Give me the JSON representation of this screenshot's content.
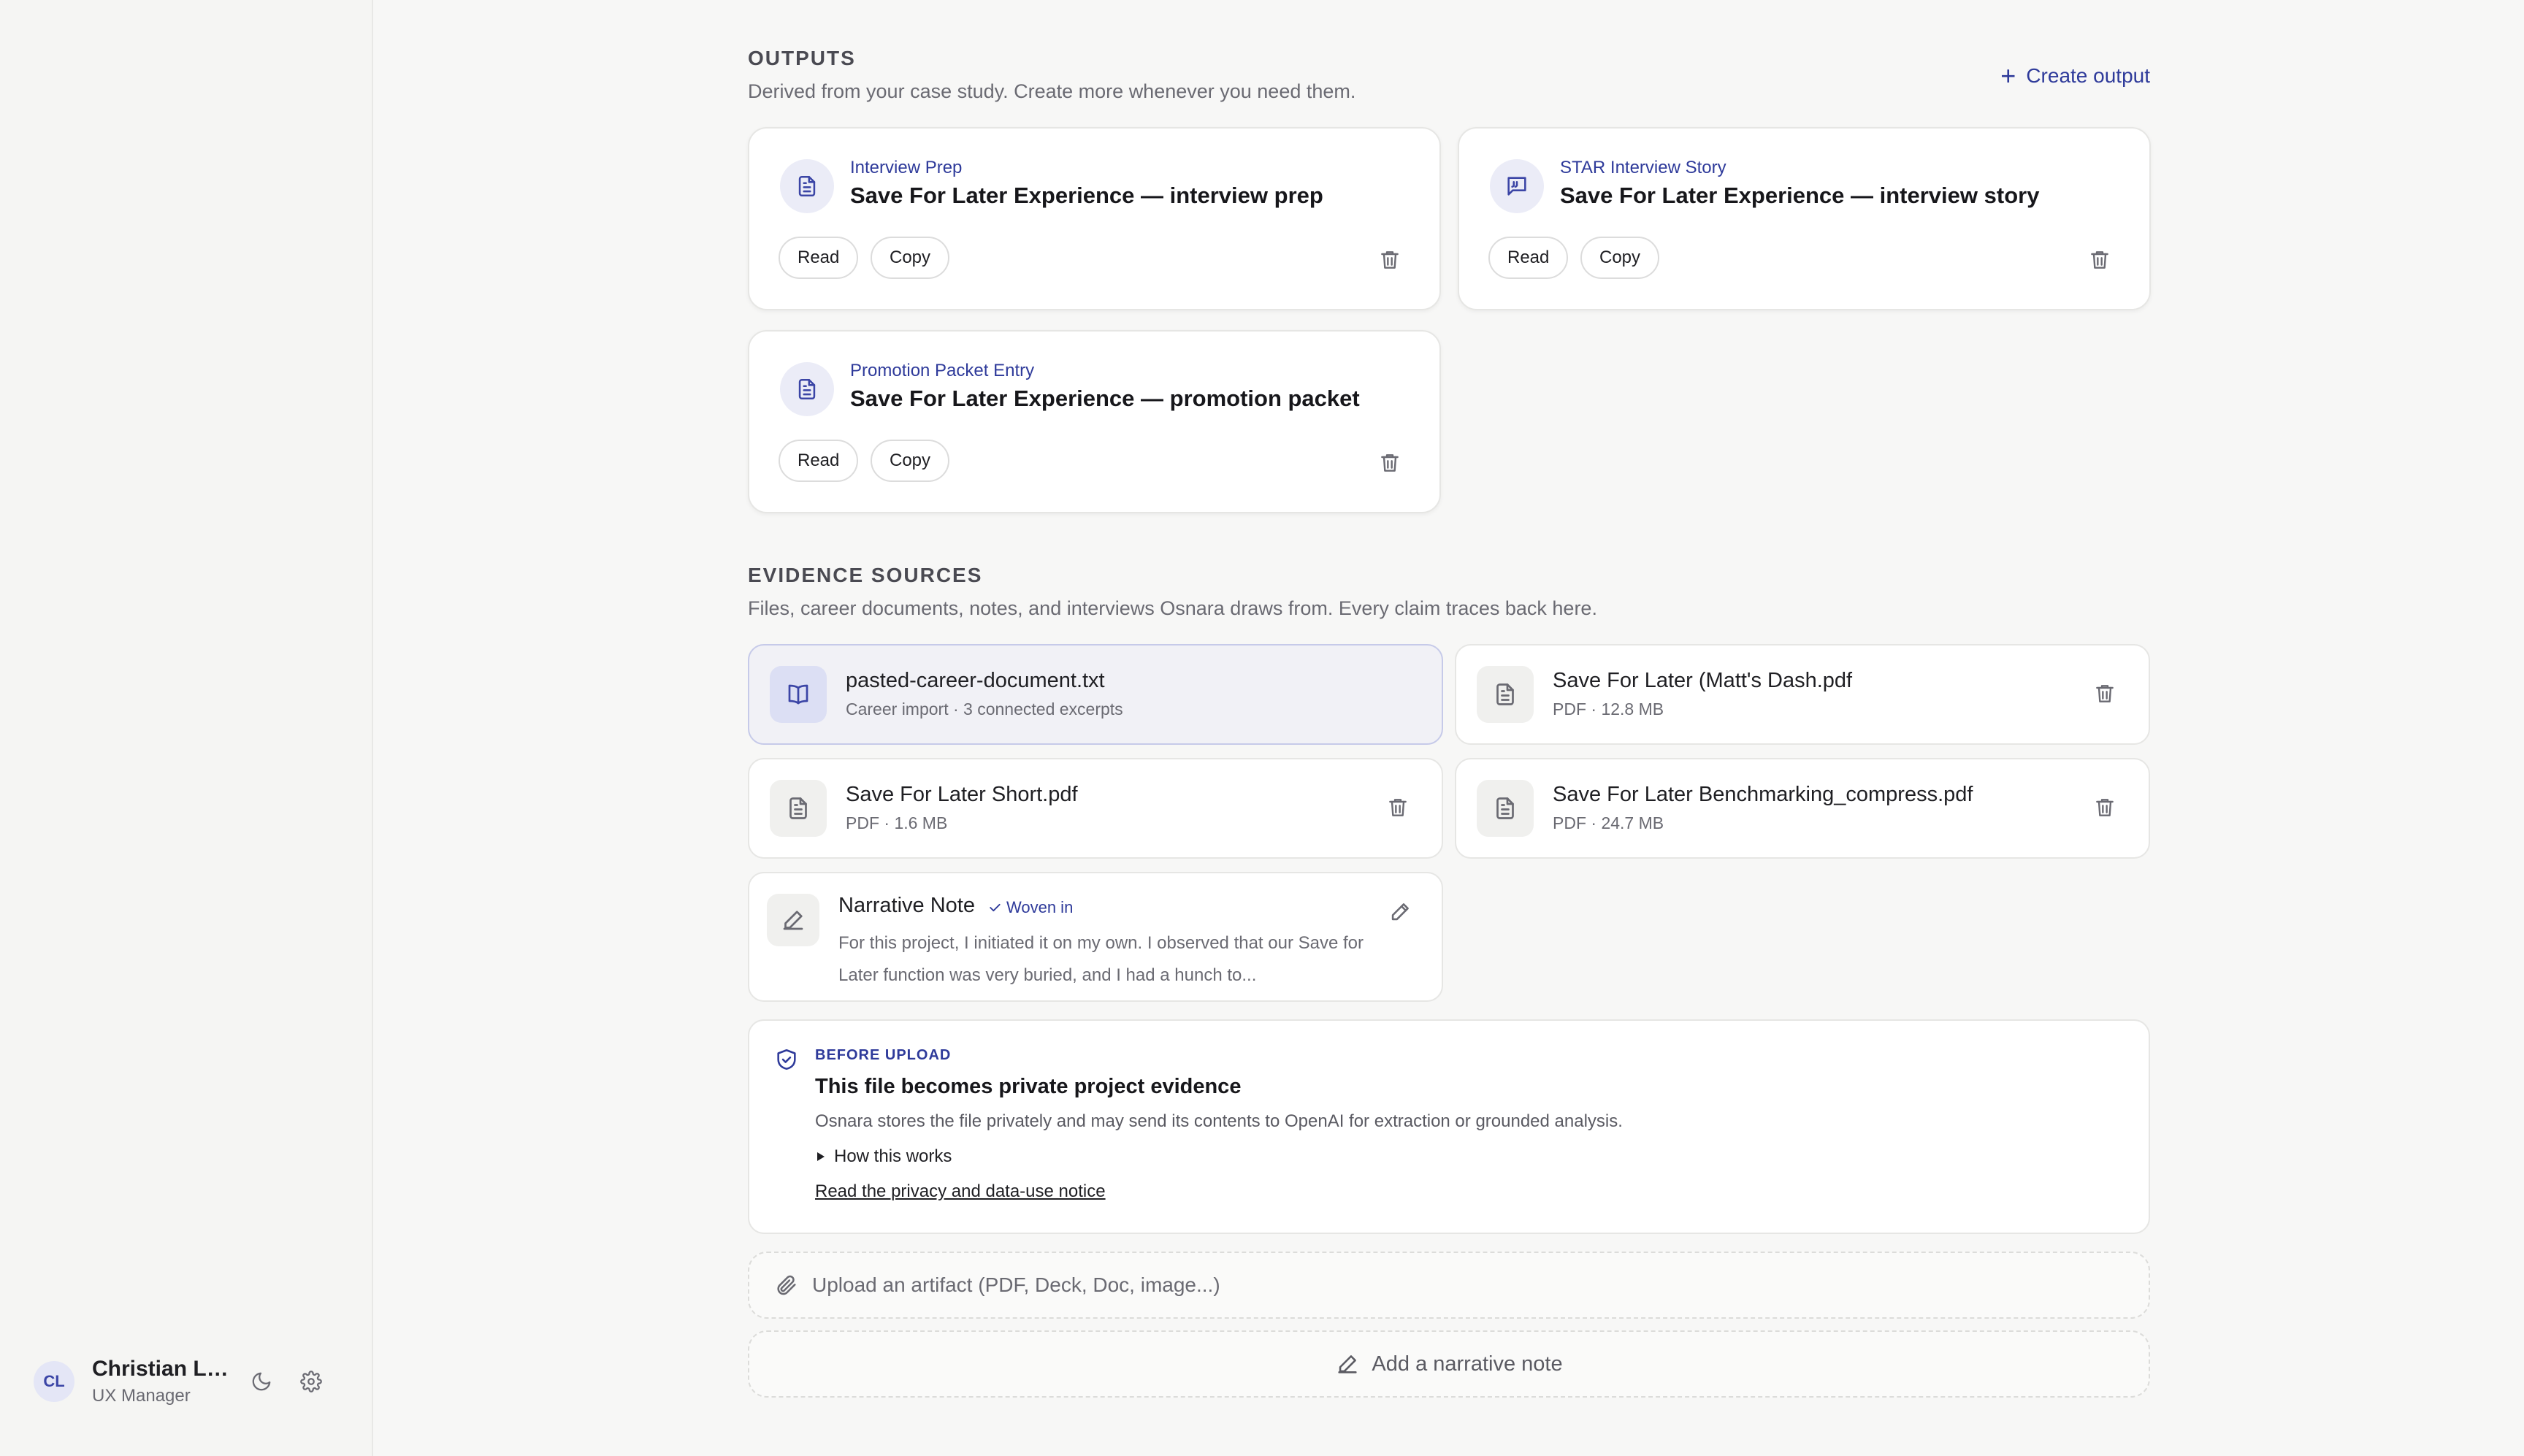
{
  "user": {
    "initials": "CL",
    "name": "Christian Lin...",
    "role": "UX Manager"
  },
  "outputs": {
    "title": "OUTPUTS",
    "subtitle": "Derived from your case study. Create more whenever you need them.",
    "create_label": "Create output",
    "cards": [
      {
        "type": "Interview Prep",
        "title": "Save For Later Experience — interview prep",
        "icon": "document-icon"
      },
      {
        "type": "STAR Interview Story",
        "title": "Save For Later Experience — interview story",
        "icon": "chat-quote-icon"
      },
      {
        "type": "Promotion Packet Entry",
        "title": "Save For Later Experience — promotion packet",
        "icon": "document-icon"
      }
    ],
    "read_label": "Read",
    "copy_label": "Copy"
  },
  "evidence": {
    "title": "EVIDENCE SOURCES",
    "subtitle": "Files, career documents, notes, and interviews Osnara draws from. Every claim traces back here.",
    "sources": [
      {
        "name": "pasted-career-document.txt",
        "meta": "Career import · 3 connected excerpts",
        "icon": "book-icon"
      },
      {
        "name": "Save For Later (Matt's Dash.pdf",
        "meta": "PDF · 12.8 MB",
        "icon": "file-icon"
      },
      {
        "name": "Save For Later Short.pdf",
        "meta": "PDF · 1.6 MB",
        "icon": "file-icon"
      },
      {
        "name": "Save For Later Benchmarking_compress.pdf",
        "meta": "PDF · 24.7 MB",
        "icon": "file-icon"
      }
    ],
    "note": {
      "name": "Narrative Note",
      "badge": "Woven in",
      "text": "For this project, I initiated it on my own. I observed that our Save for Later function was very buried, and I had a hunch to..."
    }
  },
  "notice": {
    "eyebrow": "BEFORE UPLOAD",
    "title": "This file becomes private project evidence",
    "body": "Osnara stores the file privately and may send its contents to OpenAI for extraction or grounded analysis.",
    "details": "How this works",
    "link": "Read the privacy and data-use notice"
  },
  "upload_placeholder": "Upload an artifact (PDF, Deck, Doc, image...)",
  "add_note_label": "Add a narrative note",
  "colors": {
    "accent": "#2e3a9a",
    "background": "#f7f7f6",
    "card": "#ffffff"
  }
}
